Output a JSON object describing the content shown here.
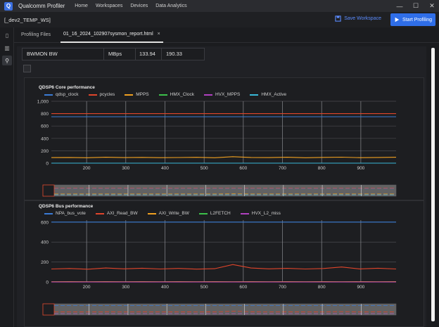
{
  "titlebar": {
    "app_title": "Qualcomm Profiler",
    "menu": [
      "Home",
      "Workspaces",
      "Devices",
      "Data Analytics"
    ],
    "controls": [
      "—",
      "☐",
      "✕"
    ]
  },
  "workspace": {
    "name": "[_dev2_TEMP_WS]",
    "save_label": "Save Workspace",
    "start_label": "Start Profiling",
    "accent": "#2f6ee8"
  },
  "sidebar": {
    "items": [
      {
        "icon": "device-icon",
        "glyph": "▯"
      },
      {
        "icon": "chart-icon",
        "glyph": "▥"
      },
      {
        "icon": "link-icon",
        "glyph": "⚲"
      }
    ]
  },
  "tabs": {
    "label": "Profiling Files",
    "active": "01_16_2024_102907sysmon_report.html",
    "close": "×"
  },
  "bw_row": {
    "name": "BWMON BW",
    "unit": "MBps",
    "v1": "133.94",
    "v2": "190.33"
  },
  "chart_data": [
    {
      "type": "line",
      "title": "QDSP6 Core performance",
      "series": [
        {
          "name": "qdsp_clock",
          "color": "#3a7bd5",
          "values": [
            750,
            750,
            750,
            750,
            750,
            750,
            750,
            750,
            750,
            750,
            750,
            750,
            750,
            750,
            750,
            750,
            750,
            750,
            750,
            750
          ]
        },
        {
          "name": "pcycles",
          "color": "#e0452b",
          "values": [
            800,
            800,
            800,
            800,
            800,
            800,
            800,
            800,
            800,
            800,
            800,
            800,
            800,
            800,
            800,
            800,
            800,
            800,
            800,
            800
          ]
        },
        {
          "name": "MPPS",
          "color": "#f0a020",
          "values": [
            90,
            92,
            88,
            95,
            90,
            93,
            89,
            91,
            94,
            88,
            105,
            92,
            90,
            95,
            88,
            93,
            97,
            89,
            92,
            95
          ]
        },
        {
          "name": "HMX_Clock",
          "color": "#3cc04a",
          "values": [
            0,
            0,
            0,
            0,
            0,
            0,
            0,
            0,
            0,
            0,
            0,
            0,
            0,
            0,
            0,
            0,
            0,
            0,
            0,
            0
          ]
        },
        {
          "name": "HVX_MPPS",
          "color": "#b040c0",
          "values": [
            0,
            0,
            0,
            0,
            0,
            0,
            0,
            0,
            0,
            0,
            0,
            0,
            0,
            0,
            0,
            0,
            0,
            0,
            0,
            0
          ]
        },
        {
          "name": "HMX_Active",
          "color": "#38b8d8",
          "values": [
            0,
            0,
            0,
            0,
            0,
            0,
            0,
            0,
            0,
            0,
            0,
            0,
            0,
            0,
            0,
            0,
            0,
            0,
            0,
            0
          ]
        }
      ],
      "x_range": [
        110,
        990
      ],
      "x_ticks": [
        "200",
        "300",
        "400",
        "500",
        "600",
        "700",
        "800",
        "900"
      ],
      "y_ticks": [
        "0",
        "200",
        "400",
        "600",
        "800",
        "1,000"
      ],
      "ylim": [
        0,
        1000
      ]
    },
    {
      "type": "line",
      "title": "QDSP6 Bus performance",
      "series": [
        {
          "name": "NPA_bus_vote",
          "color": "#3a7bd5",
          "values": [
            600,
            600,
            600,
            600,
            600,
            600,
            600,
            600,
            600,
            600,
            600,
            600,
            600,
            600,
            600,
            600,
            600,
            600,
            600,
            600
          ]
        },
        {
          "name": "AXI_Read_BW",
          "color": "#e0452b",
          "values": [
            130,
            135,
            128,
            140,
            132,
            138,
            130,
            136,
            129,
            133,
            175,
            140,
            132,
            137,
            130,
            135,
            150,
            131,
            138,
            130
          ]
        },
        {
          "name": "AXI_Write_BW",
          "color": "#f0a020",
          "values": [
            2,
            3,
            2,
            3,
            2,
            3,
            2,
            3,
            2,
            3,
            2,
            3,
            2,
            3,
            2,
            3,
            2,
            3,
            2,
            3
          ]
        },
        {
          "name": "L2FETCH",
          "color": "#3cc04a",
          "values": [
            0,
            0,
            0,
            0,
            0,
            0,
            0,
            0,
            0,
            0,
            0,
            0,
            0,
            0,
            0,
            0,
            0,
            0,
            0,
            0
          ]
        },
        {
          "name": "HVX_L2_miss",
          "color": "#b040c0",
          "values": [
            0,
            0,
            0,
            0,
            0,
            0,
            0,
            0,
            0,
            0,
            0,
            0,
            0,
            0,
            0,
            0,
            0,
            0,
            0,
            0
          ]
        }
      ],
      "x_range": [
        110,
        990
      ],
      "x_ticks": [
        "200",
        "300",
        "400",
        "500",
        "600",
        "700",
        "800",
        "900"
      ],
      "y_ticks": [
        "0",
        "200",
        "400",
        "600"
      ],
      "ylim": [
        0,
        620
      ]
    }
  ]
}
